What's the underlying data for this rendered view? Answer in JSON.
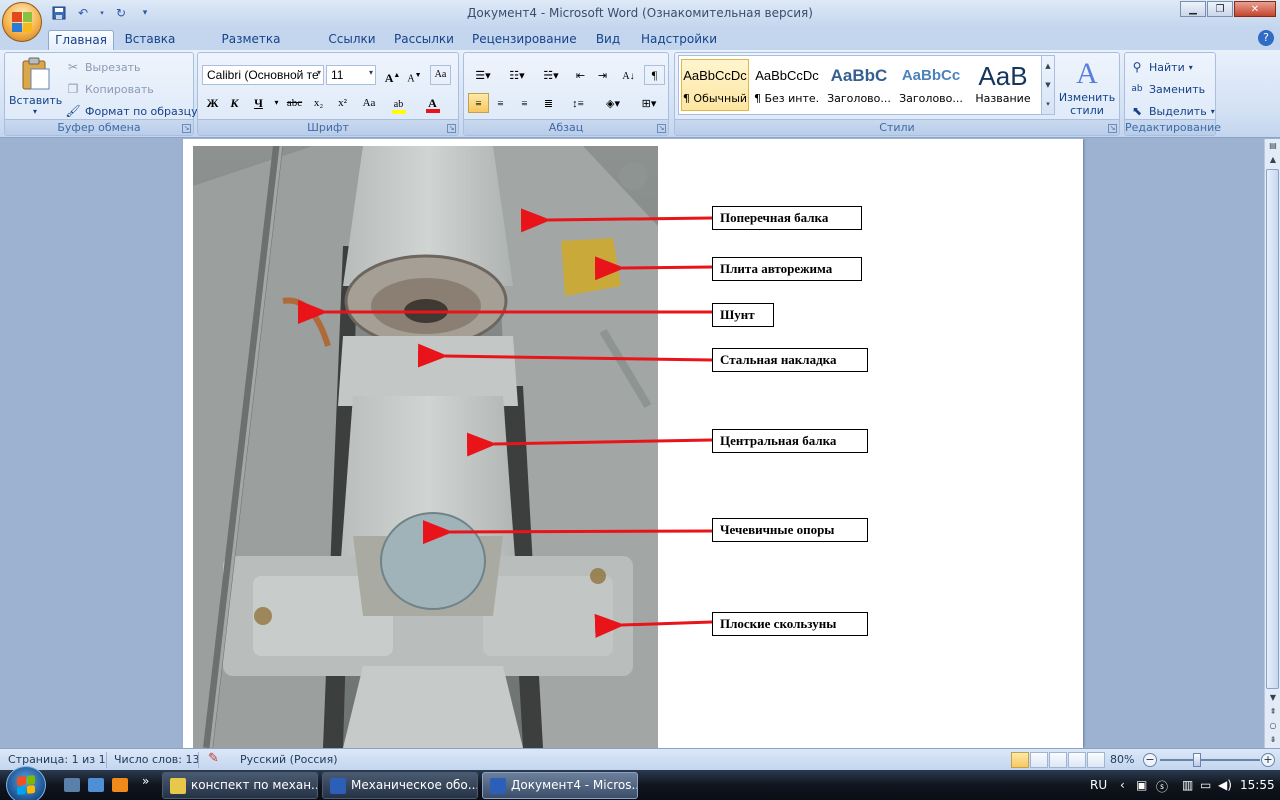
{
  "window": {
    "title": "Документ4 - Microsoft Word (Ознакомительная версия)",
    "minimize": "0",
    "maximize": "1",
    "close": "r"
  },
  "qat": {
    "save_icon": "save-icon",
    "undo_icon": "undo-icon",
    "redo_icon": "redo-icon",
    "customize_icon": "dropdown-icon"
  },
  "tabs": [
    {
      "label": "Главная",
      "active": true
    },
    {
      "label": "Вставка"
    },
    {
      "label": "Разметка страницы"
    },
    {
      "label": "Ссылки"
    },
    {
      "label": "Рассылки"
    },
    {
      "label": "Рецензирование"
    },
    {
      "label": "Вид"
    },
    {
      "label": "Надстройки"
    }
  ],
  "help_label": "?",
  "ribbon": {
    "clipboard": {
      "label": "Буфер обмена",
      "paste": "Вставить",
      "cut": "Вырезать",
      "copy": "Копировать",
      "format_painter": "Формат по образцу"
    },
    "font": {
      "label": "Шрифт",
      "font_name": "Calibri (Основной те",
      "font_size": "11",
      "bold": "Ж",
      "italic": "К",
      "underline": "Ч",
      "strike": "abc",
      "subscript": "x₂",
      "superscript": "x²",
      "change_case": "Aa",
      "grow": "A",
      "shrink": "A"
    },
    "paragraph": {
      "label": "Абзац"
    },
    "styles": {
      "label": "Стили",
      "items": [
        {
          "sample": "AaBbCcDc",
          "name": "¶ Обычный",
          "selected": true
        },
        {
          "sample": "AaBbCcDc",
          "name": "¶ Без инте..."
        },
        {
          "sample": "AaBbC",
          "name": "Заголово..."
        },
        {
          "sample": "AaBbCc",
          "name": "Заголово..."
        },
        {
          "sample": "AaB",
          "name": "Название"
        }
      ],
      "change_styles": "Изменить стили"
    },
    "editing": {
      "label": "Редактирование",
      "find": "Найти",
      "replace": "Заменить",
      "select": "Выделить"
    }
  },
  "document": {
    "callouts": [
      "Поперечная балка",
      "Плита авторежима",
      "Шунт",
      "Стальная накладка",
      "Центральная балка",
      "Чечевичные опоры",
      "Плоские скользуны"
    ]
  },
  "statusbar": {
    "page": "Страница: 1 из 1",
    "words": "Число слов: 13",
    "language": "Русский (Россия)",
    "zoom": "80%",
    "zoom_level": 0.8
  },
  "taskbar": {
    "buttons": [
      {
        "label": "конспект по механ...",
        "color": "#e8c84a"
      },
      {
        "label": "Механическое обо...",
        "color": "#2b5fb8"
      },
      {
        "label": "Документ4 - Micros...",
        "color": "#2b5fb8",
        "active": true
      }
    ],
    "lang": "RU",
    "time": "15:55"
  },
  "colors": {
    "arrow": "#e8141a",
    "ribbon_text": "#15428b"
  }
}
